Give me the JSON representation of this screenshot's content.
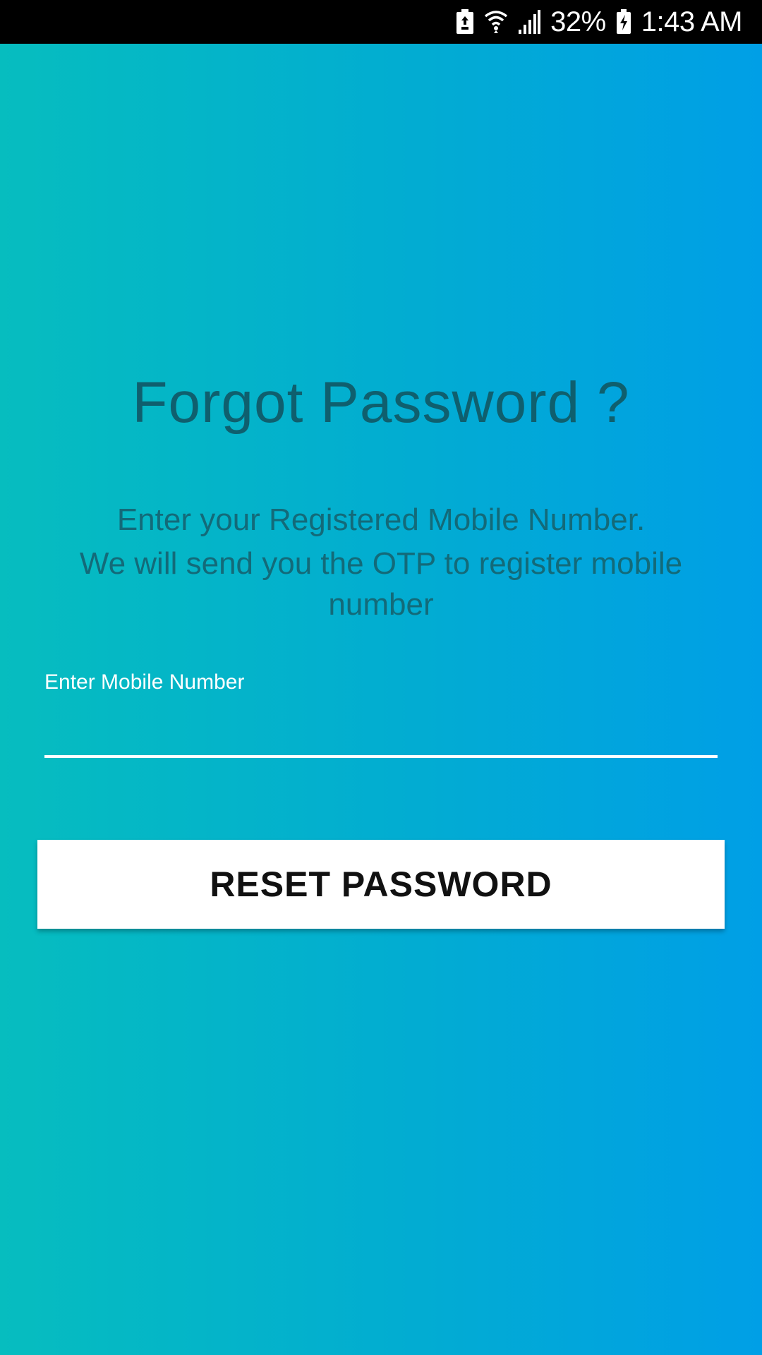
{
  "status_bar": {
    "battery_percent": "32%",
    "time": "1:43 AM",
    "icons": [
      "battery-saver-icon",
      "wifi-icon",
      "signal-icon",
      "battery-charging-icon"
    ]
  },
  "screen": {
    "title": "Forgot Password ?",
    "subtitle_line1": "Enter your Registered Mobile Number.",
    "subtitle_line2": "We will send you the OTP to register mobile number",
    "gradient_colors": [
      "#06bdbf",
      "#009fe6"
    ]
  },
  "form": {
    "mobile_label": "Enter Mobile Number",
    "mobile_value": "",
    "reset_button_label": "RESET PASSWORD"
  }
}
